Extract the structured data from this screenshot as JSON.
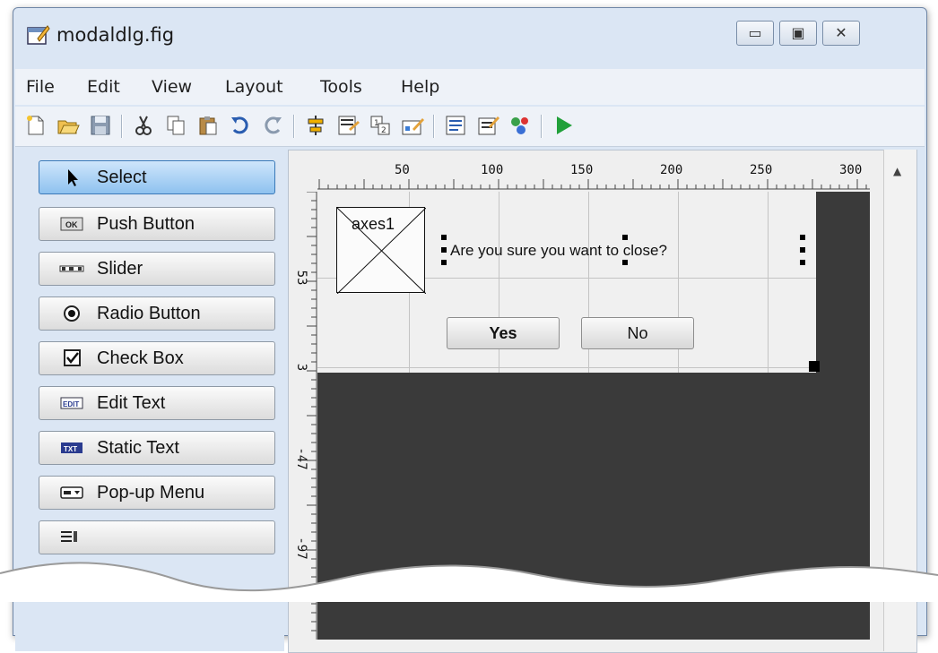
{
  "window": {
    "title": "modaldlg.fig"
  },
  "menubar": {
    "items": [
      "File",
      "Edit",
      "View",
      "Layout",
      "Tools",
      "Help"
    ]
  },
  "toolbar": {
    "icons": [
      "new-file-icon",
      "open-folder-icon",
      "save-icon",
      "cut-icon",
      "copy-icon",
      "paste-icon",
      "undo-icon",
      "redo-icon",
      "align-icon",
      "menu-editor-icon",
      "tab-order-icon",
      "toolbar-editor-icon",
      "mfile-editor-icon",
      "property-inspector-icon",
      "object-browser-icon",
      "run-icon"
    ]
  },
  "palette": {
    "items": [
      {
        "label": "Select",
        "icon": "cursor-icon",
        "selected": true
      },
      {
        "label": "Push Button",
        "icon": "push-button-icon"
      },
      {
        "label": "Slider",
        "icon": "slider-icon"
      },
      {
        "label": "Radio Button",
        "icon": "radio-button-icon"
      },
      {
        "label": "Check Box",
        "icon": "check-box-icon"
      },
      {
        "label": "Edit Text",
        "icon": "edit-text-icon"
      },
      {
        "label": "Static Text",
        "icon": "static-text-icon"
      },
      {
        "label": "Pop-up Menu",
        "icon": "popup-menu-icon"
      }
    ]
  },
  "ruler": {
    "h_ticks": [
      "50",
      "100",
      "150",
      "200",
      "250",
      "300"
    ],
    "v_ticks": [
      "53",
      "3",
      "-47",
      "-97"
    ]
  },
  "figure": {
    "axes_label": "axes1",
    "static_text": "Are you sure you want to close?",
    "yes_label": "Yes",
    "no_label": "No"
  },
  "colors": {
    "canvas": "#3a3a3a",
    "select_button": "#8ec2ef",
    "run_icon": "#21a03a"
  }
}
